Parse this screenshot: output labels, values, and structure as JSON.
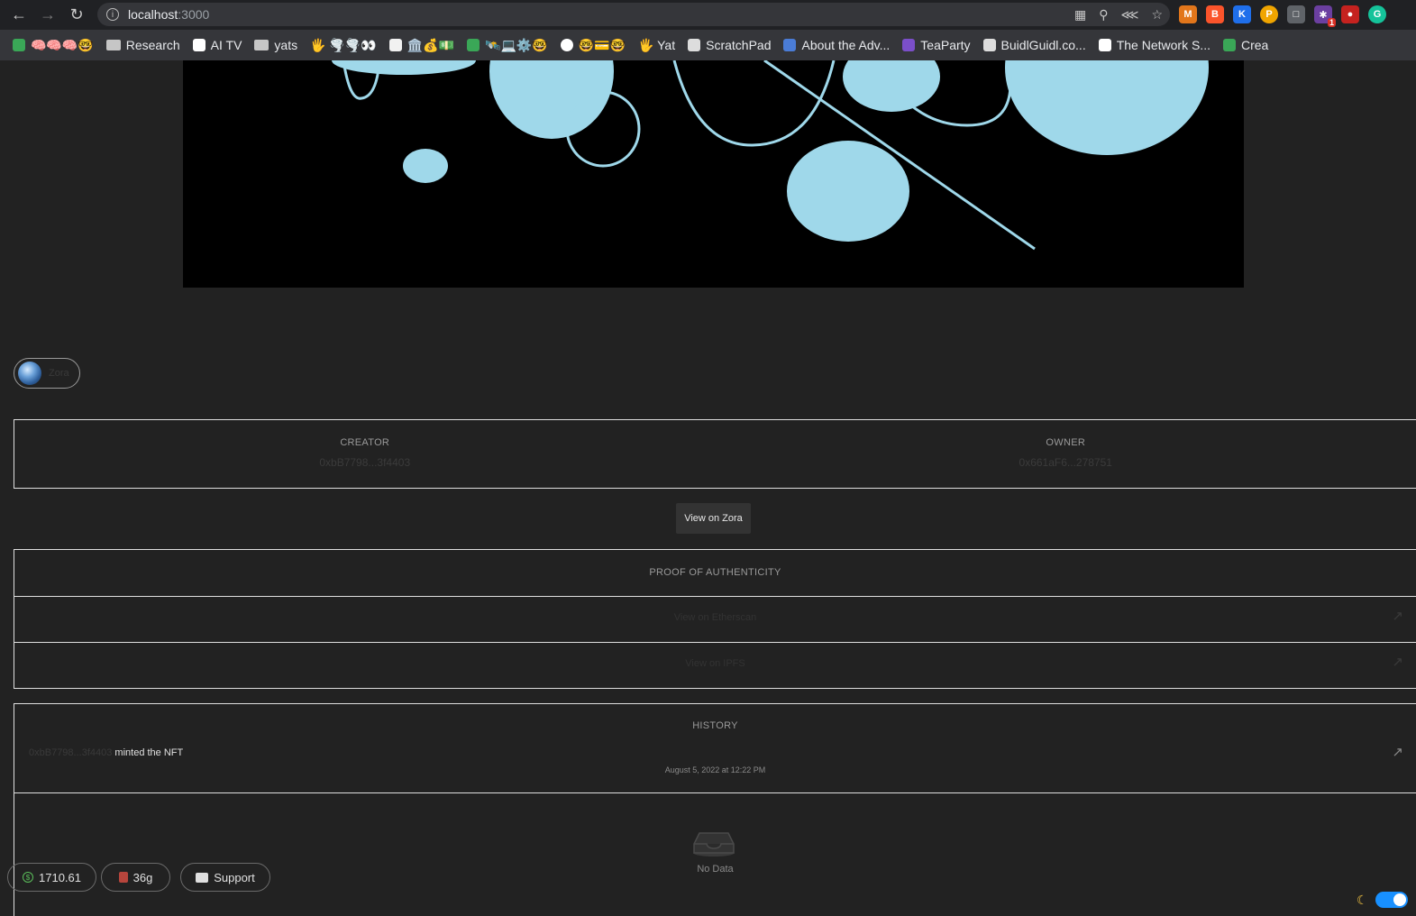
{
  "browser": {
    "url_host": "localhost",
    "url_port": ":3000",
    "extensions": [
      "metamask-icon",
      "brave-icon",
      "k-icon",
      "p-icon",
      "cube-icon",
      "puzzle-icon",
      "gamepad-icon",
      "grammarly-icon"
    ],
    "extension_badge": "1",
    "bookmarks": [
      {
        "label": "🧠🧠🧠🤓",
        "icon": "bookmark-icon"
      },
      {
        "label": "Research",
        "icon": "folder-icon"
      },
      {
        "label": "AI TV",
        "icon": "tv-icon"
      },
      {
        "label": "yats",
        "icon": "folder-icon"
      },
      {
        "label": "🖐️ 🌪️🌪️👀",
        "icon": "none"
      },
      {
        "label": "🏛️💰💵",
        "icon": "page-icon"
      },
      {
        "label": "🛰️💻⚙️🤓",
        "icon": "bookmark-icon"
      },
      {
        "label": "🤓💳🤓",
        "icon": "globe-icon"
      },
      {
        "label": "🖐️ Yat",
        "icon": "none"
      },
      {
        "label": "ScratchPad",
        "icon": "page-icon"
      },
      {
        "label": "About the Adv...",
        "icon": "bike-icon"
      },
      {
        "label": "TeaParty",
        "icon": "purple-icon"
      },
      {
        "label": "BuidlGuidl.co...",
        "icon": "image-icon"
      },
      {
        "label": "The Network S...",
        "icon": "square-icon"
      },
      {
        "label": "Crea",
        "icon": "leaf-icon"
      }
    ]
  },
  "nft": {
    "platform": "Zora",
    "creator_label": "CREATOR",
    "creator_address": "0xbB7798...3f4403",
    "owner_label": "OWNER",
    "owner_address": "0x661aF6...278751",
    "view_button": "View on Zora"
  },
  "proof": {
    "title": "PROOF OF AUTHENTICITY",
    "links": [
      "View on Etherscan",
      "View on IPFS"
    ]
  },
  "history": {
    "title": "HISTORY",
    "actor": "0xbB7798...3f4403",
    "action": " minted the NFT",
    "date": "August 5, 2022 at 12:22 PM"
  },
  "empty_state": {
    "text": "No Data"
  },
  "footer": {
    "balance": "1710.61",
    "gas": "36g",
    "support": "Support"
  },
  "colors": {
    "accent": "#1890ff",
    "art_fill": "#9fd8ea",
    "art_bg": "#000000"
  }
}
